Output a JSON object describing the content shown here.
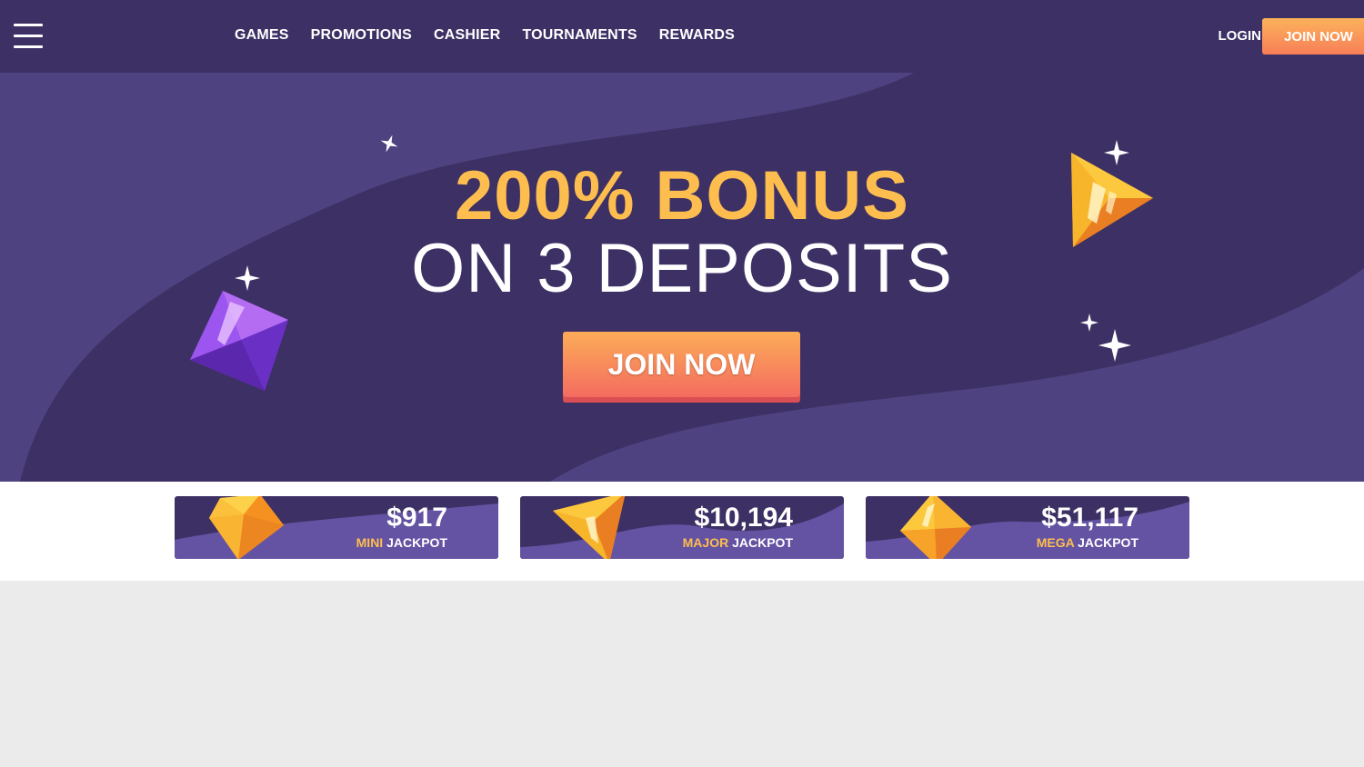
{
  "header": {
    "menu_icon": "hamburger-icon",
    "nav": [
      "GAMES",
      "PROMOTIONS",
      "CASHIER",
      "TOURNAMENTS",
      "REWARDS"
    ],
    "login_label": "LOGIN",
    "join_label": "JOIN NOW"
  },
  "hero": {
    "headline_1": "200% BONUS",
    "headline_2": "ON 3 DEPOSITS",
    "cta_label": "JOIN NOW",
    "decor_icons": [
      "purple-gem-icon",
      "play-gem-icon",
      "sparkle-icon"
    ]
  },
  "jackpots": [
    {
      "amount": "$917",
      "tier": "MINI",
      "suffix": "JACKPOT",
      "icon": "yellow-gem-icon"
    },
    {
      "amount": "$10,194",
      "tier": "MAJOR",
      "suffix": "JACKPOT",
      "icon": "triangle-gem-icon"
    },
    {
      "amount": "$51,117",
      "tier": "MEGA",
      "suffix": "JACKPOT",
      "icon": "diamond-gem-icon"
    }
  ],
  "colors": {
    "brand_purple": "#3d3064",
    "light_purple": "#4f4280",
    "accent_gold": "#fdbe4f",
    "cta_orange": "#f77e58"
  }
}
